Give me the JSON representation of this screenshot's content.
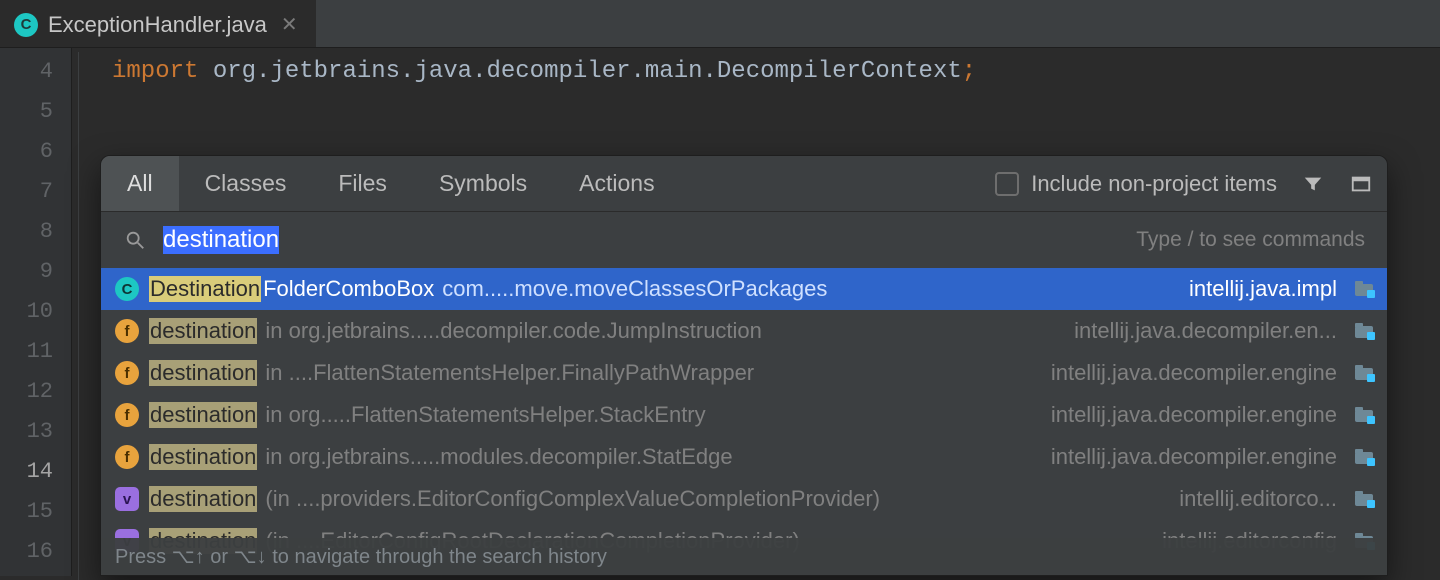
{
  "tab": {
    "filename": "ExceptionHandler.java",
    "icon_letter": "C"
  },
  "gutter": {
    "lines": [
      "4",
      "5",
      "6",
      "7",
      "8",
      "9",
      "10",
      "11",
      "12",
      "13",
      "14",
      "15",
      "16"
    ],
    "current": "14"
  },
  "code": {
    "keyword": "import",
    "line": " org.jetbrains.java.decompiler.main.DecompilerContext",
    "semi": ";"
  },
  "popup": {
    "tabs": [
      "All",
      "Classes",
      "Files",
      "Symbols",
      "Actions"
    ],
    "active_tab": "All",
    "include_label": "Include non-project items",
    "search_value": "destination",
    "placeholder": "Type / to see commands",
    "footer": "Press ⌥↑ or ⌥↓ to navigate through the search history",
    "results": [
      {
        "icon": "class",
        "icon_letter": "C",
        "match": "Destination",
        "rest": "FolderComboBox",
        "ctx": " com.....move.moveClassesOrPackages",
        "module": "intellij.java.impl",
        "selected": true
      },
      {
        "icon": "field",
        "icon_letter": "f",
        "match": "destination",
        "rest": "",
        "ctx": " in org.jetbrains.....decompiler.code.JumpInstruction",
        "module": "intellij.java.decompiler.en..."
      },
      {
        "icon": "field",
        "icon_letter": "f",
        "match": "destination",
        "rest": "",
        "ctx": " in ....FlattenStatementsHelper.FinallyPathWrapper",
        "module": "intellij.java.decompiler.engine"
      },
      {
        "icon": "field",
        "icon_letter": "f",
        "match": "destination",
        "rest": "",
        "ctx": " in org.....FlattenStatementsHelper.StackEntry",
        "module": "intellij.java.decompiler.engine"
      },
      {
        "icon": "field",
        "icon_letter": "f",
        "match": "destination",
        "rest": "",
        "ctx": " in org.jetbrains.....modules.decompiler.StatEdge",
        "module": "intellij.java.decompiler.engine"
      },
      {
        "icon": "var",
        "icon_letter": "v",
        "match": "destination",
        "rest": "",
        "ctx": " (in ....providers.EditorConfigComplexValueCompletionProvider)",
        "module": "intellij.editorco..."
      },
      {
        "icon": "var",
        "icon_letter": "v",
        "match": "destination",
        "rest": "",
        "ctx": " (in ....EditorConfigRootDeclarationCompletionProvider)",
        "module": "intellij.editorconfig"
      }
    ]
  }
}
